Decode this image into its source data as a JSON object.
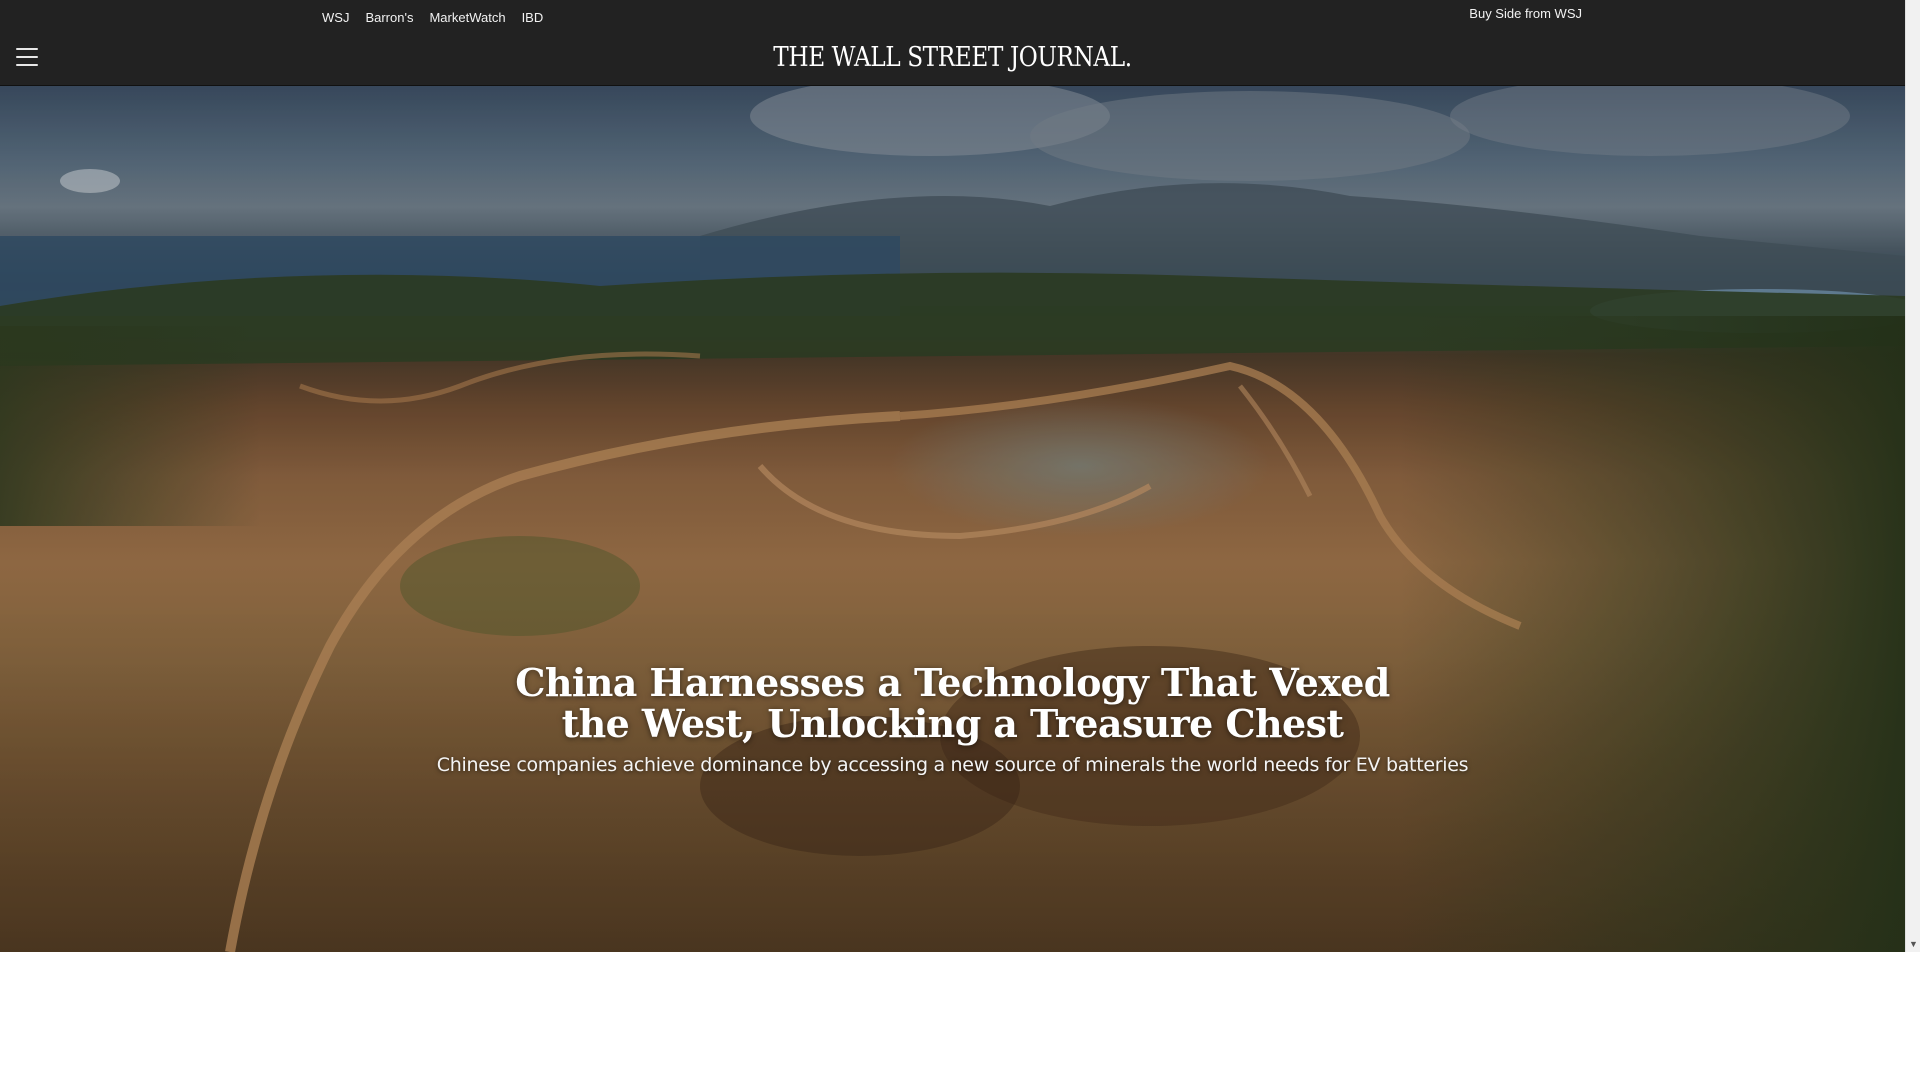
{
  "network_nav": {
    "items": [
      {
        "label": "WSJ"
      },
      {
        "label": "Barron's"
      },
      {
        "label": "MarketWatch"
      },
      {
        "label": "IBD"
      }
    ],
    "buy_side": "Buy Side from WSJ"
  },
  "header": {
    "menu_icon": "hamburger-menu-icon",
    "masthead": "THE WALL STREET JOURNAL."
  },
  "hero": {
    "headline": "China Harnesses a Technology That Vexed the West, Unlocking a Treasure Chest",
    "dek": "Chinese companies achieve dominance by accessing a new source of minerals the world needs for EV batteries"
  },
  "colors": {
    "topbar_bg": "#222222",
    "page_bg": "#ffffff",
    "text_light": "#ffffff"
  }
}
